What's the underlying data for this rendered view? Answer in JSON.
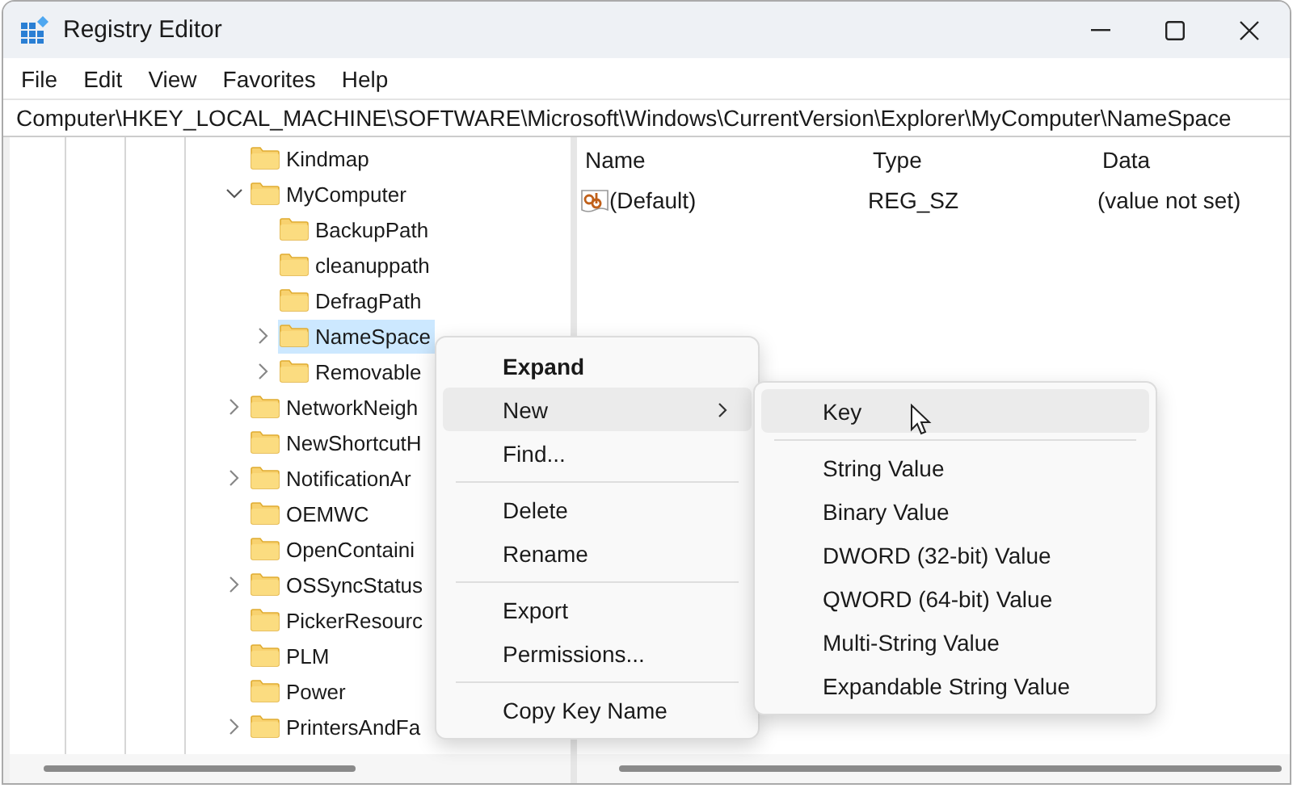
{
  "window": {
    "title": "Registry Editor"
  },
  "menu_bar": [
    "File",
    "Edit",
    "View",
    "Favorites",
    "Help"
  ],
  "address": "Computer\\HKEY_LOCAL_MACHINE\\SOFTWARE\\Microsoft\\Windows\\CurrentVersion\\Explorer\\MyComputer\\NameSpace",
  "tree": [
    {
      "label": "Kindmap",
      "selected": false
    },
    {
      "label": "MyComputer",
      "expanded": true,
      "selected": false,
      "children": [
        {
          "label": "BackupPath",
          "selected": false
        },
        {
          "label": "cleanuppath",
          "selected": false
        },
        {
          "label": "DefragPath",
          "selected": false
        },
        {
          "label": "NameSpace",
          "expanded": false,
          "selected": true
        },
        {
          "label": "Removable",
          "expanded": false,
          "selected": false
        }
      ]
    },
    {
      "label": "NetworkNeigh",
      "expanded": false,
      "selected": false
    },
    {
      "label": "NewShortcutH",
      "selected": false
    },
    {
      "label": "NotificationAr",
      "expanded": false,
      "selected": false
    },
    {
      "label": "OEMWC",
      "selected": false
    },
    {
      "label": "OpenContaini",
      "selected": false
    },
    {
      "label": "OSSyncStatus",
      "expanded": false,
      "selected": false
    },
    {
      "label": "PickerResourc",
      "selected": false
    },
    {
      "label": "PLM",
      "selected": false
    },
    {
      "label": "Power",
      "selected": false
    },
    {
      "label": "PrintersAndFa",
      "expanded": false,
      "selected": false
    }
  ],
  "values_table": {
    "columns": [
      "Name",
      "Type",
      "Data"
    ],
    "rows": [
      {
        "name": "(Default)",
        "type": "REG_SZ",
        "data": "(value not set)"
      }
    ]
  },
  "context_menu": {
    "items": [
      {
        "kind": "item",
        "label": "Expand",
        "bold": true,
        "highlighted": false,
        "submenu": false
      },
      {
        "kind": "item",
        "label": "New",
        "bold": false,
        "highlighted": true,
        "submenu": true
      },
      {
        "kind": "item",
        "label": "Find...",
        "bold": false,
        "highlighted": false,
        "submenu": false
      },
      {
        "kind": "separator"
      },
      {
        "kind": "item",
        "label": "Delete",
        "bold": false,
        "highlighted": false,
        "submenu": false
      },
      {
        "kind": "item",
        "label": "Rename",
        "bold": false,
        "highlighted": false,
        "submenu": false
      },
      {
        "kind": "separator"
      },
      {
        "kind": "item",
        "label": "Export",
        "bold": false,
        "highlighted": false,
        "submenu": false
      },
      {
        "kind": "item",
        "label": "Permissions...",
        "bold": false,
        "highlighted": false,
        "submenu": false
      },
      {
        "kind": "separator"
      },
      {
        "kind": "item",
        "label": "Copy Key Name",
        "bold": false,
        "highlighted": false,
        "submenu": false
      }
    ]
  },
  "submenu": {
    "items": [
      {
        "kind": "item",
        "label": "Key",
        "highlighted": true
      },
      {
        "kind": "separator"
      },
      {
        "kind": "item",
        "label": "String Value",
        "highlighted": false
      },
      {
        "kind": "item",
        "label": "Binary Value",
        "highlighted": false
      },
      {
        "kind": "item",
        "label": "DWORD (32-bit) Value",
        "highlighted": false
      },
      {
        "kind": "item",
        "label": "QWORD (64-bit) Value",
        "highlighted": false
      },
      {
        "kind": "item",
        "label": "Multi-String Value",
        "highlighted": false
      },
      {
        "kind": "item",
        "label": "Expandable String Value",
        "highlighted": false
      }
    ]
  }
}
